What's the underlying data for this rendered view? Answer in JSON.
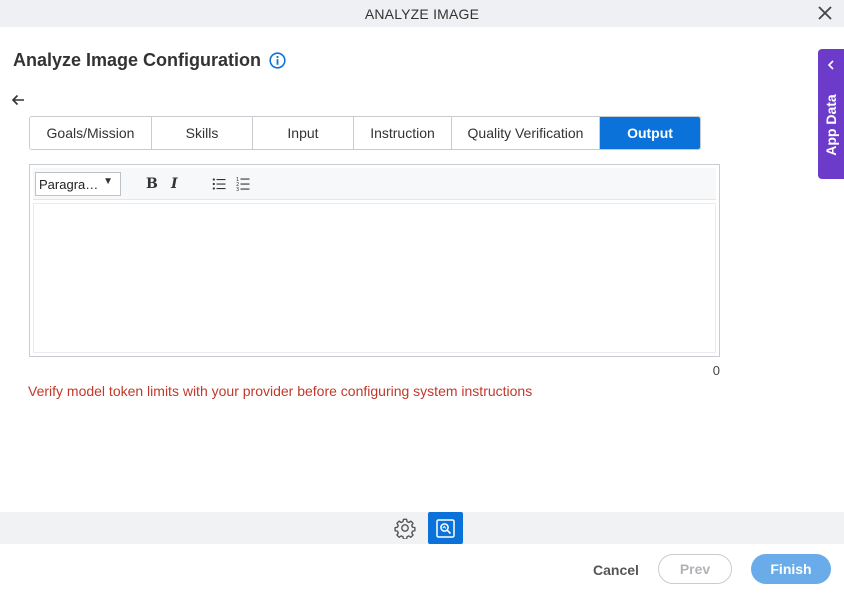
{
  "window": {
    "title": "ANALYZE IMAGE"
  },
  "page": {
    "title": "Analyze Image Configuration"
  },
  "tabs": [
    {
      "label": "Goals/Mission",
      "active": false
    },
    {
      "label": "Skills",
      "active": false
    },
    {
      "label": "Input",
      "active": false
    },
    {
      "label": "Instruction",
      "active": false
    },
    {
      "label": "Quality Verification",
      "active": false
    },
    {
      "label": "Output",
      "active": true
    }
  ],
  "editor": {
    "format_value": "Paragra…",
    "bold_label": "B",
    "italic_label": "I",
    "content": "",
    "char_count": "0"
  },
  "warning": {
    "text": "Verify model token limits with your provider before configuring system instructions"
  },
  "footer": {
    "cancel_label": "Cancel",
    "prev_label": "Prev",
    "finish_label": "Finish"
  },
  "side_panel": {
    "label": "App Data"
  },
  "icons": {
    "close": "close-icon",
    "info": "info-icon",
    "back": "back-arrow-icon",
    "bullet_list": "bullet-list-icon",
    "numbered_list": "numbered-list-icon",
    "settings": "gear-icon",
    "analyze": "image-analyze-icon",
    "side_chevron": "chevron-left-icon"
  },
  "colors": {
    "accent": "#0a72d8",
    "warning": "#c0392b",
    "side_panel": "#6c3bc9",
    "finish_disabled": "#6aabe9"
  }
}
